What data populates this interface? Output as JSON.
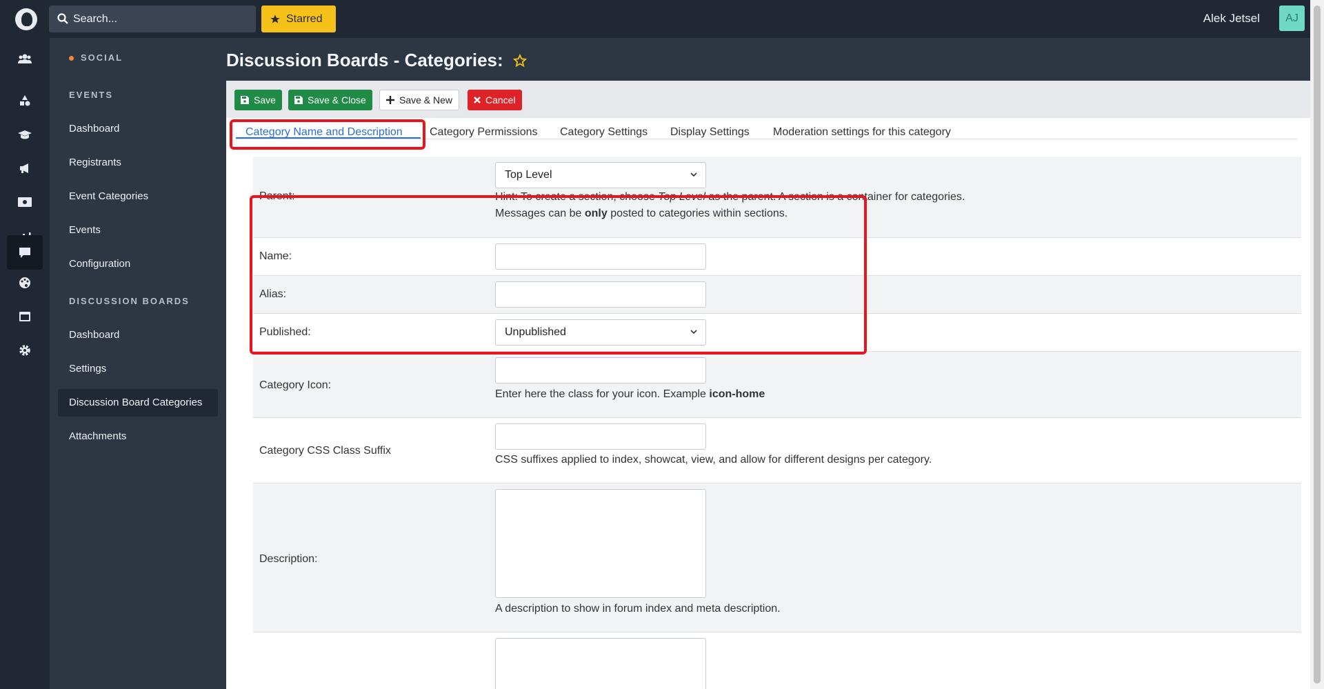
{
  "topbar": {
    "search_placeholder": "Search...",
    "starred_label": "Starred",
    "user_name": "Alek Jetsel",
    "avatar_initials": "AJ"
  },
  "rail": {
    "icons": [
      "users-icon",
      "shapes-icon",
      "graduation-cap-icon",
      "megaphone-icon",
      "money-bill-icon",
      "chart-icon",
      "comment-icon",
      "palette-icon",
      "window-icon",
      "gear-icon"
    ],
    "active": "comment-icon"
  },
  "nav": {
    "social_header": "SOCIAL",
    "events_header": "EVENTS",
    "events_items": [
      "Dashboard",
      "Registrants",
      "Event Categories",
      "Events",
      "Configuration"
    ],
    "boards_header": "DISCUSSION BOARDS",
    "boards_items": [
      "Dashboard",
      "Settings",
      "Discussion Board Categories",
      "Attachments"
    ],
    "active_item": "Discussion Board Categories"
  },
  "page": {
    "title": "Discussion Boards - Categories:"
  },
  "toolbar": {
    "save": "Save",
    "save_close": "Save & Close",
    "save_new": "Save & New",
    "cancel": "Cancel"
  },
  "tabs": [
    "Category Name and Description",
    "Category Permissions",
    "Category Settings",
    "Display Settings",
    "Moderation settings for this category"
  ],
  "form": {
    "parent_label": "Parent:",
    "parent_value": "Top Level",
    "parent_hint_1a": "Hint: To create a section, choose ",
    "parent_hint_1b": "Top Level",
    "parent_hint_1c": " as the parent. A section is a container for categories.",
    "parent_hint_2a": "Messages can be ",
    "parent_hint_2b": "only",
    "parent_hint_2c": " posted to categories within sections.",
    "name_label": "Name:",
    "alias_label": "Alias:",
    "published_label": "Published:",
    "published_value": "Unpublished",
    "icon_label": "Category Icon:",
    "icon_hint_a": "Enter here the class for your icon. Example ",
    "icon_hint_b": "icon-home",
    "css_label": "Category CSS Class Suffix",
    "css_hint": "CSS suffixes applied to index, showcat, view, and allow for different designs per category.",
    "desc_label": "Description:",
    "desc_hint": "A description to show in forum index and meta description."
  }
}
